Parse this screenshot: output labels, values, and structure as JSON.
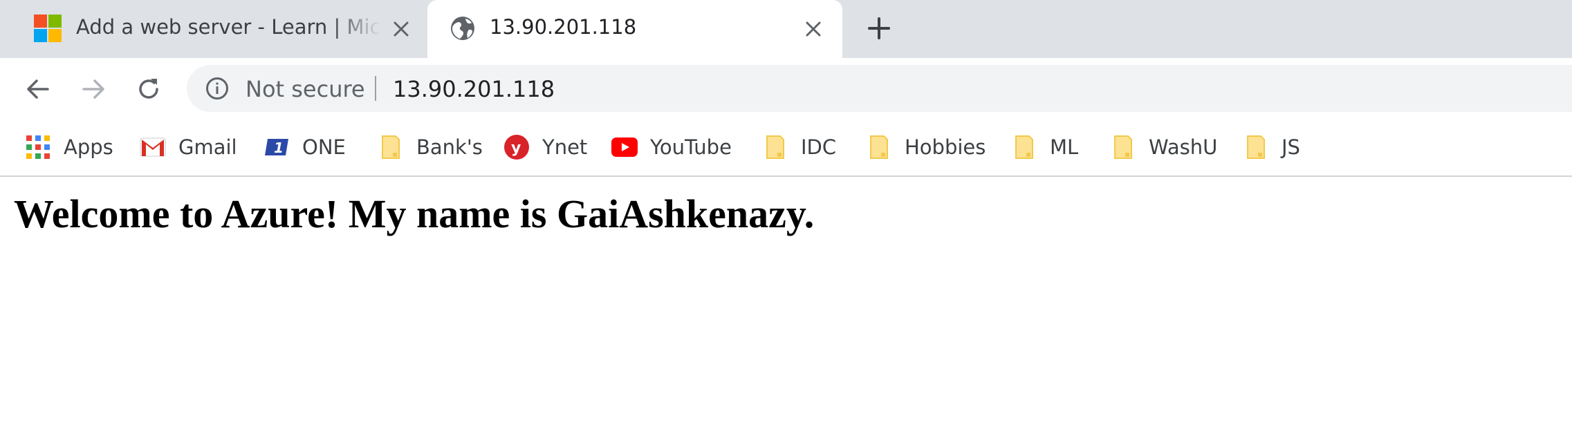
{
  "tabs": [
    {
      "title": "Add a web server - Learn | Microsoft",
      "icon": "microsoft-logo-icon",
      "active": false
    },
    {
      "title": "13.90.201.118",
      "icon": "globe-icon",
      "active": true
    }
  ],
  "toolbar": {
    "security_label": "Not secure",
    "url": "13.90.201.118"
  },
  "bookmarks": [
    {
      "label": "Apps",
      "icon": "apps-grid-icon"
    },
    {
      "label": "Gmail",
      "icon": "gmail-icon"
    },
    {
      "label": "ONE",
      "icon": "one-icon"
    },
    {
      "label": "Bank's",
      "icon": "folder-icon"
    },
    {
      "label": "Ynet",
      "icon": "ynet-icon"
    },
    {
      "label": "YouTube",
      "icon": "youtube-icon"
    },
    {
      "label": "IDC",
      "icon": "folder-icon"
    },
    {
      "label": "Hobbies",
      "icon": "folder-icon"
    },
    {
      "label": "ML",
      "icon": "folder-icon"
    },
    {
      "label": "WashU",
      "icon": "folder-icon"
    },
    {
      "label": "JS",
      "icon": "folder-icon"
    }
  ],
  "page": {
    "heading": "Welcome to Azure! My name is GaiAshkenazy."
  },
  "colors": {
    "tabstrip": "#dee1e6",
    "omnibox": "#f1f3f4",
    "folder": "#fde293",
    "youtube": "#ff0000",
    "ynet": "#d8232a"
  }
}
